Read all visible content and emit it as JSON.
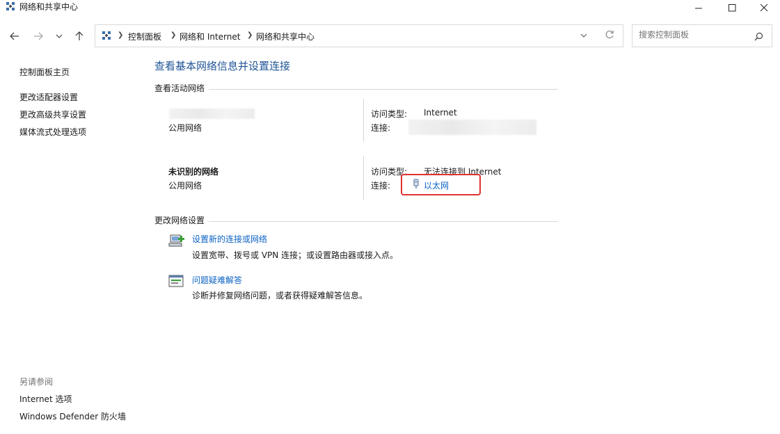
{
  "window": {
    "title": "网络和共享中心"
  },
  "address": {
    "crumbs": [
      "控制面板",
      "网络和 Internet",
      "网络和共享中心"
    ]
  },
  "search": {
    "placeholder": "搜索控制面板"
  },
  "sidebar": {
    "items": [
      {
        "label": "控制面板主页"
      },
      {
        "label": "更改适配器设置"
      },
      {
        "label": "更改高级共享设置"
      },
      {
        "label": "媒体流式处理选项"
      }
    ],
    "see_also": {
      "heading": "另请参阅",
      "items": [
        {
          "label": "Internet 选项"
        },
        {
          "label": "Windows Defender 防火墙"
        }
      ]
    }
  },
  "main": {
    "title": "查看基本网络信息并设置连接",
    "active_networks_heading": "查看活动网络",
    "networks": [
      {
        "name": "",
        "category": "公用网络",
        "access_label": "访问类型:",
        "access_value": "Internet",
        "connection_label": "连接:",
        "connection_value": ""
      },
      {
        "name": "未识别的网络",
        "category": "公用网络",
        "access_label": "访问类型:",
        "access_value": "无法连接到 Internet",
        "connection_label": "连接:",
        "connection_value": "以太网"
      }
    ],
    "change_settings_heading": "更改网络设置",
    "tasks": [
      {
        "title": "设置新的连接或网络",
        "desc": "设置宽带、拨号或 VPN 连接；或设置路由器或接入点。",
        "icon": "new-connection-icon"
      },
      {
        "title": "问题疑难解答",
        "desc": "诊断并修复网络问题，或者获得疑难解答信息。",
        "icon": "troubleshoot-icon"
      }
    ]
  },
  "colors": {
    "title_blue": "#1f5496",
    "link_blue": "#0b62c4",
    "highlight_red": "#e0332e"
  }
}
